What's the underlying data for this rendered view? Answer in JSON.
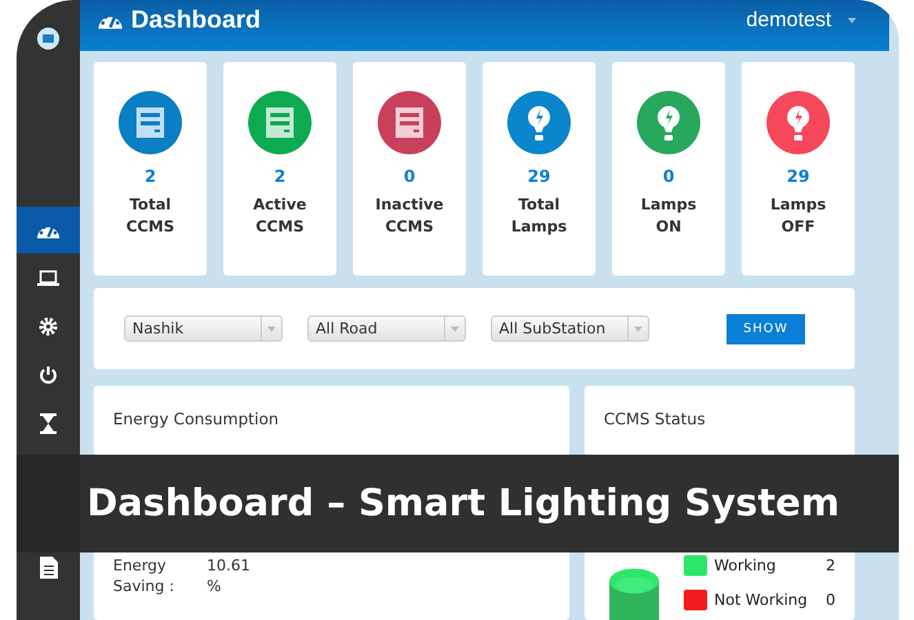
{
  "sidebar": {
    "items": [
      {
        "kind": "logo",
        "selected": false
      },
      {
        "kind": "dashboard",
        "selected": true
      },
      {
        "kind": "laptop",
        "selected": false
      },
      {
        "kind": "gear",
        "selected": false
      },
      {
        "kind": "power",
        "selected": false
      },
      {
        "kind": "hourglass",
        "selected": false
      },
      {
        "kind": "document",
        "selected": false
      }
    ]
  },
  "header": {
    "title": "Dashboard",
    "user": "demotest"
  },
  "stats": [
    {
      "kind": "ccms",
      "value": "2",
      "label": "Total CCMS",
      "color": "#0a7fc4"
    },
    {
      "kind": "ccms",
      "value": "2",
      "label": "Active CCMS",
      "color": "#0daa4f"
    },
    {
      "kind": "ccms",
      "value": "0",
      "label": "Inactive CCMS",
      "color": "#c9405a"
    },
    {
      "kind": "lamp",
      "value": "29",
      "label": "Total Lamps",
      "color": "#0a86cc"
    },
    {
      "kind": "lamp",
      "value": "0",
      "label": "Lamps ON",
      "color": "#27a85c"
    },
    {
      "kind": "lamp",
      "value": "29",
      "label": "Lamps OFF",
      "color": "#f5485a"
    }
  ],
  "filters": {
    "selects": [
      {
        "value": "Nashik"
      },
      {
        "value": "All Road"
      },
      {
        "value": "All SubStation"
      }
    ],
    "button": "SHOW"
  },
  "energy": {
    "title": "Energy Consumption",
    "label": "Energy Saving :",
    "value": "10.61 %"
  },
  "status": {
    "title": "CCMS Status",
    "legend": [
      {
        "label": "Working",
        "count": "2",
        "color": "#2ee66a"
      },
      {
        "label": "Not Working",
        "count": "0",
        "color": "#f41c1c"
      }
    ]
  },
  "banner": {
    "caption": "Dashboard – Smart Lighting System"
  }
}
